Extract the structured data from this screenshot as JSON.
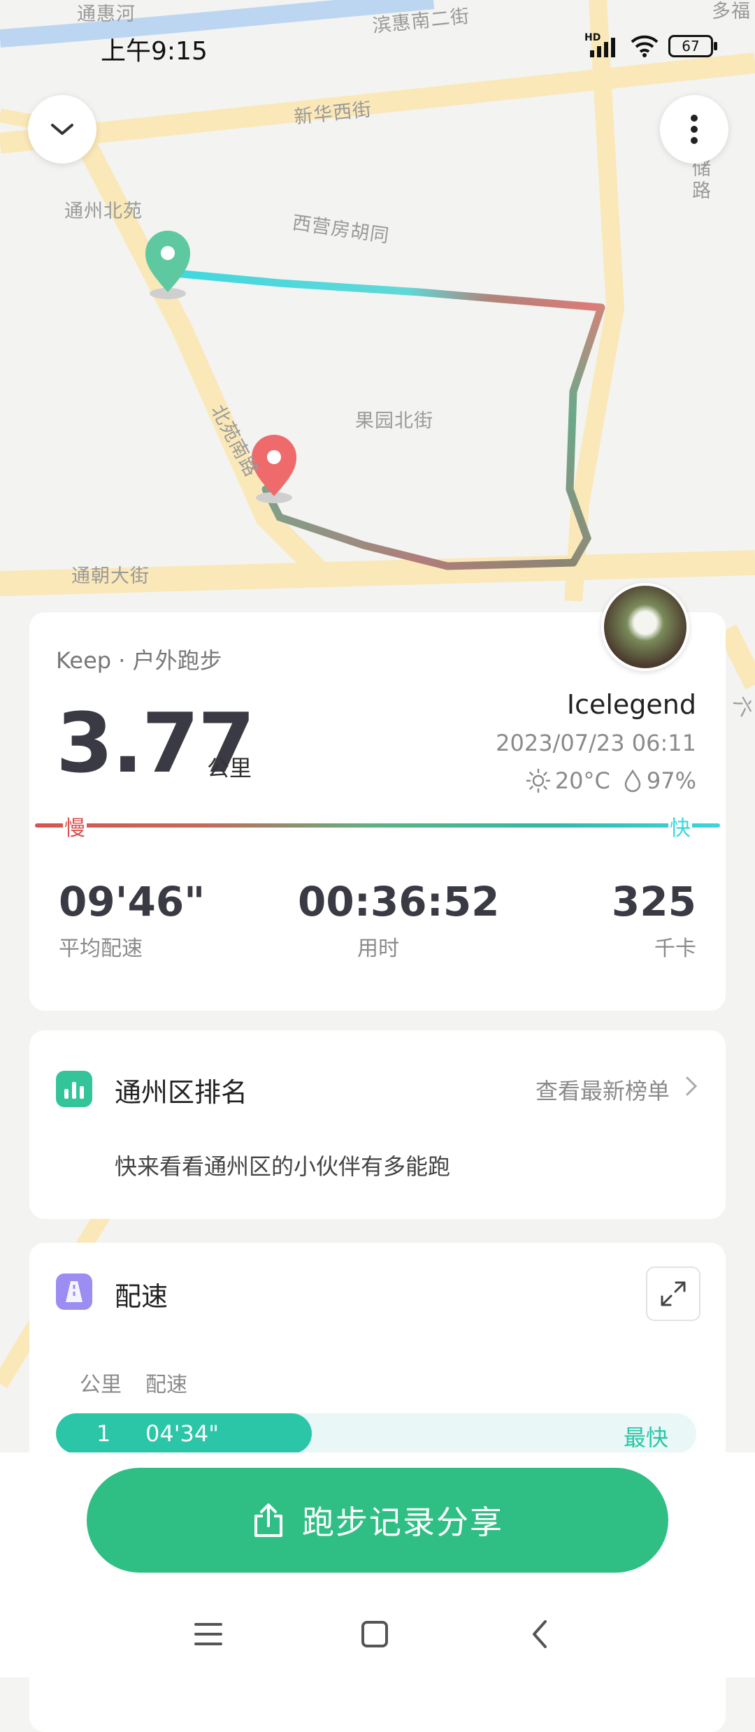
{
  "status_bar": {
    "time": "上午9:15",
    "battery": "67",
    "network": "HD"
  },
  "map": {
    "labels": [
      "通惠河",
      "滨惠南二街",
      "多福",
      "新华西街",
      "储路",
      "通州北苑",
      "西营房胡同",
      "果园北街",
      "北苑南路",
      "通朝大街",
      "六"
    ]
  },
  "summary": {
    "source": "Keep · 户外跑步",
    "distance": "3.77",
    "distance_unit": "公里",
    "username": "Icelegend",
    "datetime": "2023/07/23 06:11",
    "temperature": "20°C",
    "humidity": "97%",
    "pace_slow_label": "慢",
    "pace_fast_label": "快",
    "stats": [
      {
        "value": "09'46\"",
        "label": "平均配速"
      },
      {
        "value": "00:36:52",
        "label": "用时"
      },
      {
        "value": "325",
        "label": "千卡"
      }
    ]
  },
  "ranking": {
    "title": "通州区排名",
    "link": "查看最新榜单",
    "description": "快来看看通州区的小伙伴有多能跑"
  },
  "pace_section": {
    "title": "配速",
    "col_km": "公里",
    "col_pace": "配速",
    "rows": [
      {
        "km": "1",
        "pace": "04'34\"",
        "tag": "最快",
        "fill_fraction": 0.4
      }
    ]
  },
  "share": {
    "label": "跑步记录分享"
  }
}
